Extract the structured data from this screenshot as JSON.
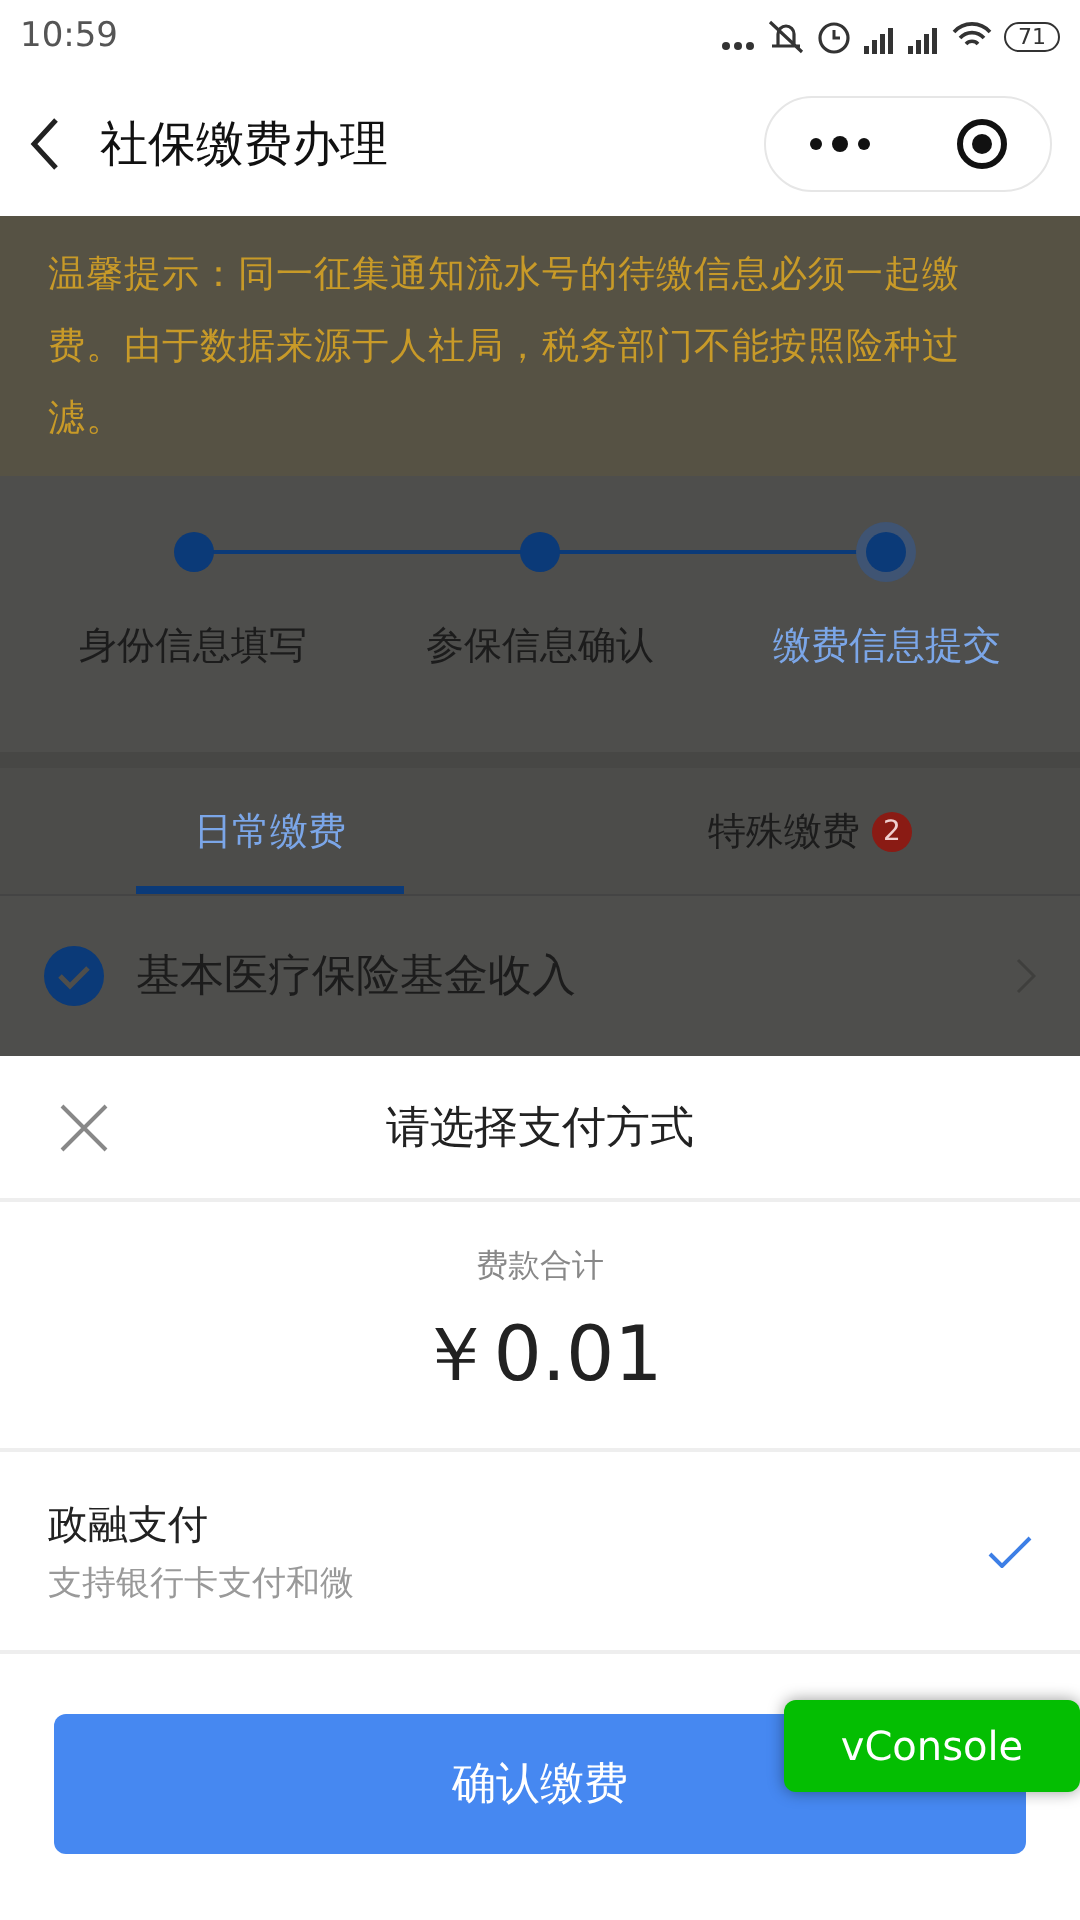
{
  "status_bar": {
    "time": "10:59",
    "battery": "71"
  },
  "nav": {
    "title": "社保缴费办理"
  },
  "notice": "温馨提示：同一征集通知流水号的待缴信息必须一起缴费。由于数据来源于人社局，税务部门不能按照险种过滤。",
  "steps": [
    {
      "label": "身份信息填写",
      "selected": false
    },
    {
      "label": "参保信息确认",
      "selected": false
    },
    {
      "label": "缴费信息提交",
      "selected": true
    }
  ],
  "tabs": [
    {
      "label": "日常缴费",
      "selected": true
    },
    {
      "label": "特殊缴费",
      "selected": false,
      "badge": "2"
    }
  ],
  "items": [
    {
      "label": "基本医疗保险基金收入",
      "checked": true
    }
  ],
  "sheet": {
    "title": "请选择支付方式",
    "total_label": "费款合计",
    "total_amount": "￥0.01",
    "payment_methods": [
      {
        "name": "政融支付",
        "description": "支持银行卡支付和微",
        "selected": true
      }
    ],
    "confirm_button": "确认缴费"
  },
  "vconsole": "vConsole"
}
